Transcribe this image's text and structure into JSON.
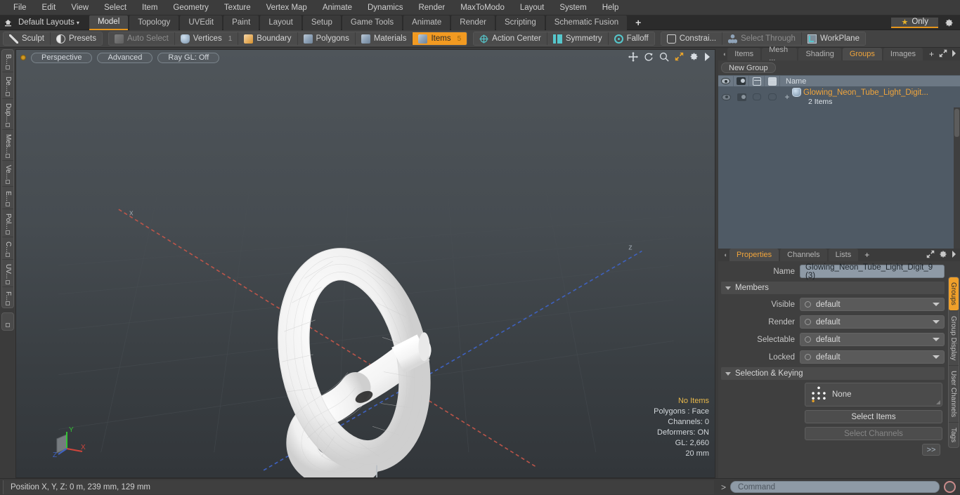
{
  "menubar": {
    "items": [
      "File",
      "Edit",
      "View",
      "Select",
      "Item",
      "Geometry",
      "Texture",
      "Vertex Map",
      "Animate",
      "Dynamics",
      "Render",
      "MaxToModo",
      "Layout",
      "System",
      "Help"
    ]
  },
  "layoutbar": {
    "home_icon": "home-icon",
    "layout_selector": "Default Layouts",
    "caret": "▾",
    "tabs": [
      {
        "label": "Model",
        "active": true
      },
      {
        "label": "Topology",
        "active": false
      },
      {
        "label": "UVEdit",
        "active": false
      },
      {
        "label": "Paint",
        "active": false
      },
      {
        "label": "Layout",
        "active": false
      },
      {
        "label": "Setup",
        "active": false
      },
      {
        "label": "Game Tools",
        "active": false
      },
      {
        "label": "Animate",
        "active": false
      },
      {
        "label": "Render",
        "active": false
      },
      {
        "label": "Scripting",
        "active": false
      },
      {
        "label": "Schematic Fusion",
        "active": false
      }
    ],
    "add_tab": "+",
    "only_star": "★",
    "only_label": "Only",
    "settings_icon": "gear-icon"
  },
  "modebar": {
    "group1": [
      {
        "label": "Sculpt",
        "icon": "sculpt-icon",
        "state": "normal"
      },
      {
        "label": "Presets",
        "icon": "presets-icon",
        "state": "normal"
      }
    ],
    "group2": [
      {
        "label": "Auto Select",
        "icon": "cube-icon",
        "state": "disabled",
        "count": ""
      },
      {
        "label": "Vertices",
        "icon": "shield-icon",
        "state": "normal",
        "count": "1"
      },
      {
        "label": "Boundary",
        "icon": "boundary-icon",
        "state": "normal",
        "count": ""
      },
      {
        "label": "Polygons",
        "icon": "cube-icon",
        "state": "normal",
        "count": ""
      },
      {
        "label": "Materials",
        "icon": "cube-icon",
        "state": "normal",
        "count": ""
      },
      {
        "label": "Items",
        "icon": "cube-icon",
        "state": "active",
        "count": "5"
      }
    ],
    "group3": [
      {
        "label": "Action Center",
        "icon": "crosshair-icon",
        "state": "normal"
      },
      {
        "label": "Symmetry",
        "icon": "symmetry-icon",
        "state": "normal"
      },
      {
        "label": "Falloff",
        "icon": "falloff-icon",
        "state": "normal"
      }
    ],
    "group4": [
      {
        "label": "Constrai...",
        "icon": "constraint-icon",
        "state": "normal"
      },
      {
        "label": "Select Through",
        "icon": "select-through-icon",
        "state": "disabled"
      },
      {
        "label": "WorkPlane",
        "icon": "workplane-icon",
        "state": "normal"
      }
    ]
  },
  "left_rail": {
    "tabs": [
      "B...",
      "De...",
      "Dup...",
      "Mes...",
      "Ve...",
      "E...",
      "Pol...",
      "C...",
      "UV...",
      "F..."
    ]
  },
  "viewport": {
    "dot": "viewport-indicator",
    "pills": [
      "Perspective",
      "Advanced",
      "Ray GL: Off"
    ],
    "tools": [
      "move-icon",
      "rotate-icon",
      "zoom-icon",
      "maximize-icon",
      "gear-icon",
      "play-icon"
    ],
    "stats": {
      "selection": "No Items",
      "polygons": "Polygons : Face",
      "channels": "Channels: 0",
      "deformers": "Deformers: ON",
      "gl": "GL: 2,660",
      "scale": "20 mm"
    },
    "axis": {
      "x": "X",
      "y": "Y",
      "z": "Z",
      "z_label": "z"
    }
  },
  "groups_panel": {
    "tabs": [
      {
        "label": "Items",
        "active": false
      },
      {
        "label": "Mesh ...",
        "active": false
      },
      {
        "label": "Shading",
        "active": false
      },
      {
        "label": "Groups",
        "active": true
      },
      {
        "label": "Images",
        "active": false
      }
    ],
    "add_tab": "+",
    "new_group_button": "New Group",
    "columns": [
      "eye-icon",
      "camera-icon",
      "cube-outline-icon",
      "cube-solid-icon",
      "Name"
    ],
    "name_header": "Name",
    "rows": [
      {
        "expander": "+",
        "icon": "group-icon",
        "name": "Glowing_Neon_Tube_Light_Digit...",
        "subtitle": "2 Items"
      }
    ]
  },
  "properties_panel": {
    "tabs": [
      {
        "label": "Properties",
        "active": true
      },
      {
        "label": "Channels",
        "active": false
      },
      {
        "label": "Lists",
        "active": false
      }
    ],
    "add_tab": "+",
    "name_label": "Name",
    "name_value": "Glowing_Neon_Tube_Light_Digit_9 (3)",
    "members_section": "Members",
    "fields": [
      {
        "label": "Visible",
        "value": "default"
      },
      {
        "label": "Render",
        "value": "default"
      },
      {
        "label": "Selectable",
        "value": "default"
      },
      {
        "label": "Locked",
        "value": "default"
      }
    ],
    "selection_section": "Selection & Keying",
    "set_value": "None",
    "select_items_button": "Select Items",
    "select_channels_button": "Select Channels",
    "expand_button": ">>"
  },
  "right_rail": {
    "tabs": [
      {
        "label": "Groups",
        "active": true
      },
      {
        "label": "Group Display",
        "active": false
      },
      {
        "label": "User Channels",
        "active": false
      },
      {
        "label": "Tags",
        "active": false
      }
    ]
  },
  "statusbar": {
    "position_text": "Position X, Y, Z:   0 m, 239 mm, 129 mm",
    "prompt": ">",
    "command_placeholder": "Command",
    "record_icon": "record-icon"
  },
  "colors": {
    "accent": "#f0a53c",
    "active_tab": "#e6951c",
    "panel_bg": "#3f3f3f",
    "list_bg": "#4f5a65",
    "field_bg": "#8e9aa6"
  }
}
